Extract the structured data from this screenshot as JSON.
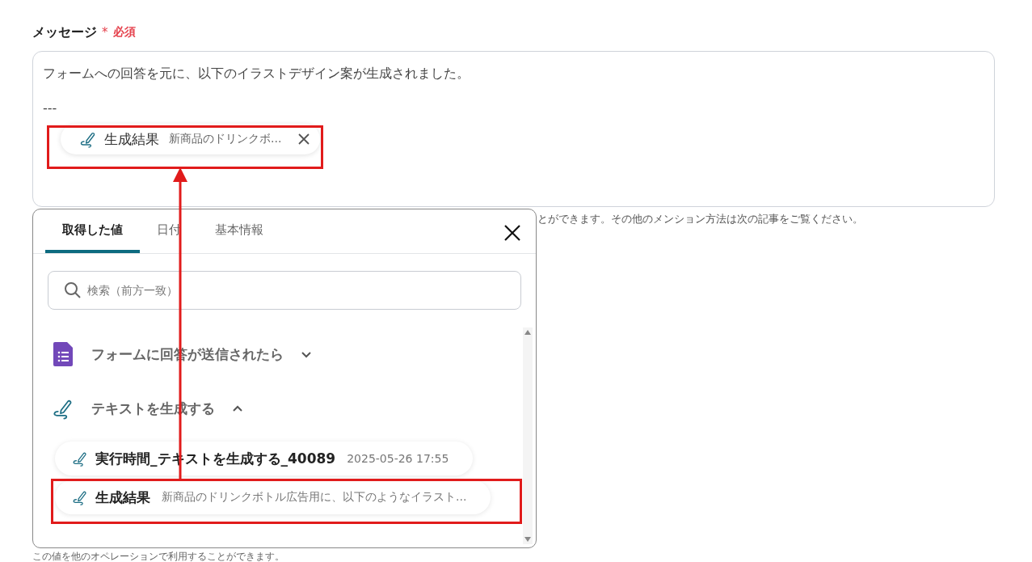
{
  "field": {
    "label": "メッセージ",
    "required_mark": "*",
    "required_label": "必須",
    "text_lines": [
      "フォームへの回答を元に、以下のイラストデザイン案が生成されました。",
      "---"
    ],
    "chip": {
      "title": "生成結果",
      "value": "新商品のドリンクボ..."
    },
    "hint": "とができます。その他のメンション方法は次の記事をご覧ください。"
  },
  "popup": {
    "tabs": [
      {
        "label": "取得した値",
        "selected": true
      },
      {
        "label": "日付",
        "selected": false
      },
      {
        "label": "基本情報",
        "selected": false
      }
    ],
    "search": {
      "placeholder": "検索（前方一致）"
    },
    "groups": [
      {
        "kind": "form",
        "title": "フォームに回答が送信されたら",
        "expanded": false
      },
      {
        "kind": "ai",
        "title": "テキストを生成する",
        "expanded": true,
        "items": [
          {
            "title": "実行時間_テキストを生成する_40089",
            "value": "2025-05-26 17:55"
          },
          {
            "title": "生成結果",
            "value": "新商品のドリンクボトル広告用に、以下のようなイラスト..."
          }
        ]
      }
    ],
    "footer": "この値を他のオペレーションで利用することができます。"
  }
}
